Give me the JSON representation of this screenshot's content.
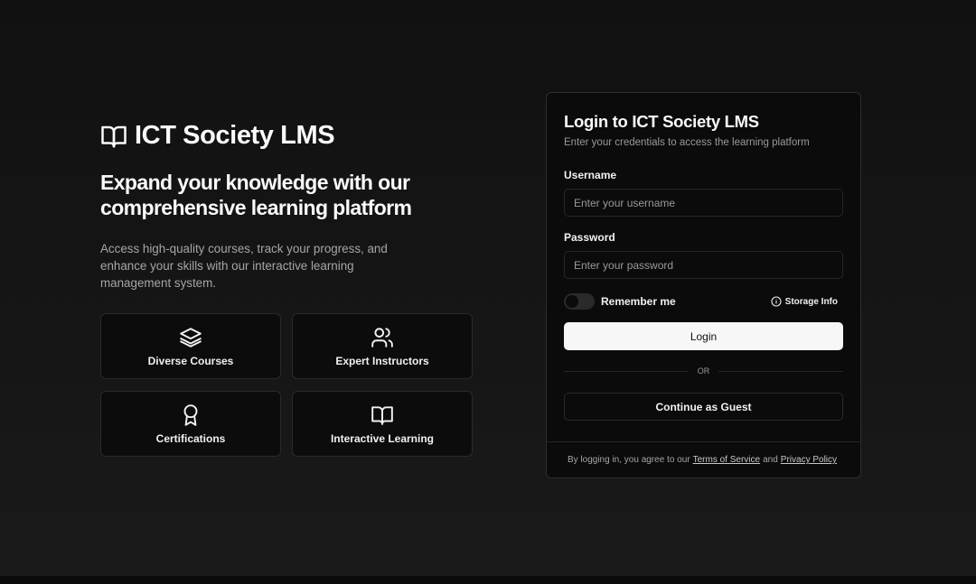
{
  "brand": {
    "title": "ICT Society LMS",
    "icon": "book-open-icon"
  },
  "hero": {
    "headline": "Expand your knowledge with our comprehensive learning platform",
    "description": "Access high-quality courses, track your progress, and enhance your skills with our interactive learning management system."
  },
  "features": [
    {
      "label": "Diverse Courses",
      "icon": "layers-icon"
    },
    {
      "label": "Expert Instructors",
      "icon": "users-icon"
    },
    {
      "label": "Certifications",
      "icon": "award-icon"
    },
    {
      "label": "Interactive Learning",
      "icon": "book-open-icon"
    }
  ],
  "login": {
    "title": "Login to ICT Society LMS",
    "subtitle": "Enter your credentials to access the learning platform",
    "username_label": "Username",
    "username_placeholder": "Enter your username",
    "username_value": "",
    "password_label": "Password",
    "password_placeholder": "Enter your password",
    "password_value": "",
    "remember_label": "Remember me",
    "remember_on": false,
    "storage_label": "Storage Info",
    "login_button": "Login",
    "divider_text": "OR",
    "guest_button": "Continue as Guest",
    "footer_prefix": "By logging in, you agree to our",
    "footer_terms": "Terms of Service",
    "footer_and": "and",
    "footer_privacy": "Privacy Policy"
  },
  "colors": {
    "background": "#111111",
    "card": "#0b0b0b",
    "primary_button": "#f7f7f7",
    "muted_text": "#9a9a9a"
  }
}
